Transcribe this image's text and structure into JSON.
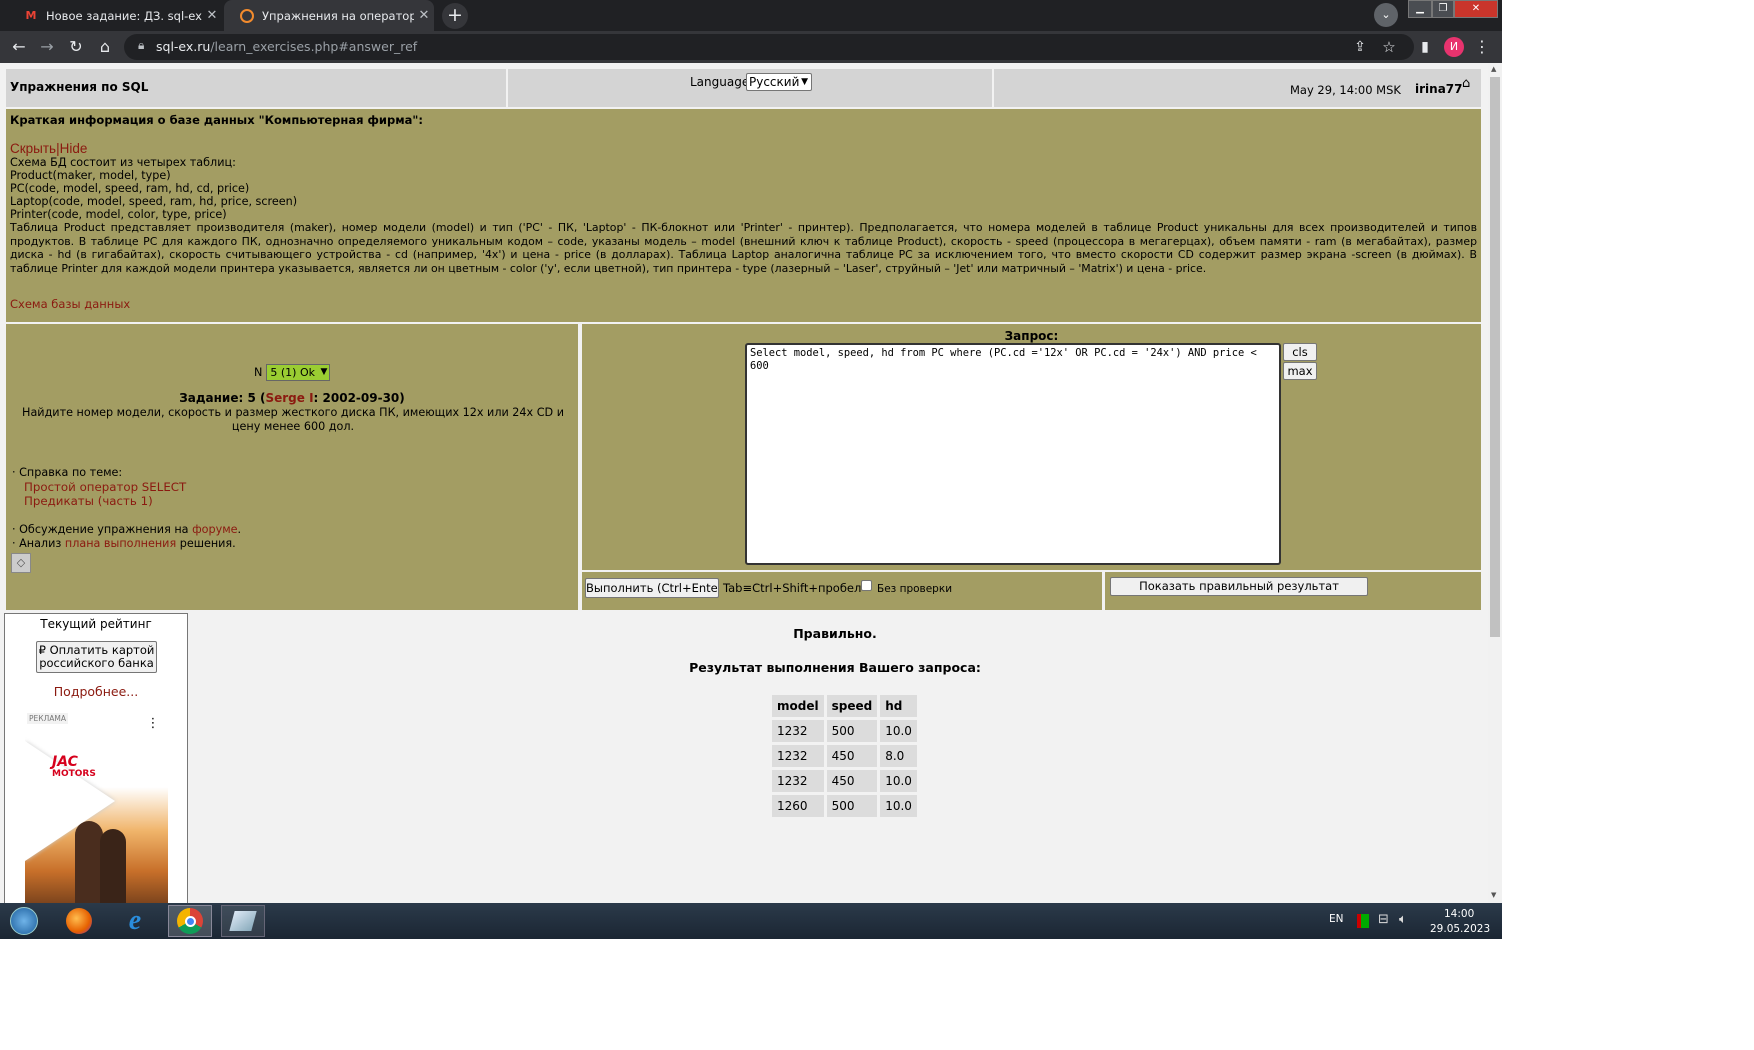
{
  "browser": {
    "tabs": [
      {
        "label": "Новое задание: ДЗ. sql-ex.ru За...",
        "icon": "gmail-icon",
        "active": false
      },
      {
        "label": "Упражнения на оператор SELEC",
        "icon": "sqlex-icon",
        "active": true
      }
    ],
    "url_host": "sql-ex.ru",
    "url_path": "/learn_exercises.php#answer_ref",
    "avatar_letter": "И"
  },
  "header": {
    "title": "Упражнения по SQL",
    "language_label": "Language",
    "language_value": "Русский",
    "datetime": "May 29, 14:00 MSK",
    "username": "irina77"
  },
  "dbinfo": {
    "title": "Краткая информация о базе данных \"Компьютерная фирма\":",
    "hide_link": "Скрыть|Hide",
    "lines": [
      "Схема БД состоит из четырех таблиц:",
      "Product(maker, model, type)",
      "PC(code, model, speed, ram, hd, cd, price)",
      "Laptop(code, model, speed, ram, hd, price, screen)",
      "Printer(code, model, color, type, price)"
    ],
    "description": "Таблица Product представляет производителя (maker), номер модели (model) и тип ('PC' - ПК, 'Laptop' - ПК-блокнот или 'Printer' - принтер). Предполагается, что номера моделей в таблице Product уникальны для всех производителей и типов продуктов. В таблице PC для каждого ПК, однозначно определяемого уникальным кодом – code, указаны модель – model (внешний ключ к таблице Product), скорость - speed (процессора в мегагерцах), объем памяти - ram (в мегабайтах), размер диска - hd (в гигабайтах), скорость считывающего устройства - cd (например, '4x') и цена - price (в долларах). Таблица Laptop аналогична таблице PC за исключением того, что вместо скорости CD содержит размер экрана -screen (в дюймах). В таблице Printer для каждой модели принтера указывается, является ли он цветным - color ('y', если цветной), тип принтера - type (лазерный – 'Laser', струйный – 'Jet' или матричный – 'Matrix') и цена - price.",
    "schema_link": "Схема базы данных"
  },
  "task": {
    "n_label": "N",
    "selected": "5 (1) Ok",
    "title_prefix": "Задание: 5 (",
    "author": "Serge I",
    "title_suffix": ": 2002-09-30)",
    "text": "Найдите номер модели, скорость и размер жесткого диска ПК, имеющих 12x или 24x CD и цену менее 600 дол.",
    "help_label": "· Справка по теме:",
    "help_links": [
      "Простой оператор SELECT",
      "Предикаты (часть 1)"
    ],
    "forum_prefix": "· Обсуждение упражнения на ",
    "forum_link": "форуме",
    "forum_suffix": ".",
    "plan_prefix": "· Анализ ",
    "plan_link": "плана выполнения",
    "plan_suffix": " решения."
  },
  "query": {
    "label": "Запрос:",
    "sql": "Select model, speed, hd from PC where (PC.cd ='12x' OR PC.cd = '24x') AND price < 600",
    "cls_label": "cls",
    "max_label": "max",
    "run_label": "Выполнить (Ctrl+Enter)",
    "tab_hint": "Tab≡Ctrl+Shift+пробел",
    "no_check_label": "Без проверки",
    "show_correct_label": "Показать правильный результат"
  },
  "rating": {
    "title": "Текущий рейтинг",
    "pay_label": "₽ Оплатить картой российского банка",
    "more_link": "Подробнее...",
    "ad_badge": "РЕКЛАМА",
    "ad_brand_1": "JAC",
    "ad_brand_2": "MOTORS"
  },
  "result": {
    "status": "Правильно.",
    "heading": "Результат выполнения Вашего запроса:",
    "columns": [
      "model",
      "speed",
      "hd"
    ],
    "rows": [
      [
        "1232",
        "500",
        "10.0"
      ],
      [
        "1232",
        "450",
        "8.0"
      ],
      [
        "1232",
        "450",
        "10.0"
      ],
      [
        "1260",
        "500",
        "10.0"
      ]
    ]
  },
  "taskbar": {
    "lang": "EN",
    "time": "14:00",
    "date": "29.05.2023"
  }
}
